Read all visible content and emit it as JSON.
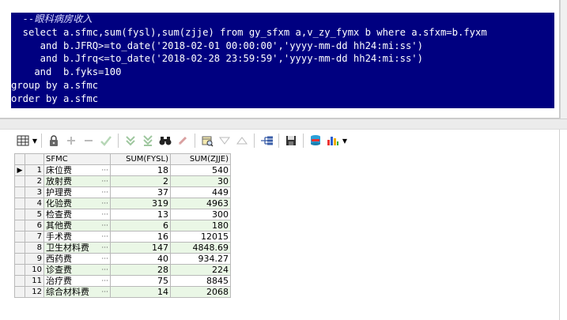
{
  "sql": {
    "lines": [
      "  --眼科病房收入",
      "  select a.sfmc,sum(fysl),sum(zjje) from gy_sfxm a,v_zy_fymx b where a.sfxm=b.fyxm",
      "     and b.JFRQ>=to_date('2018-02-01 00:00:00','yyyy-mm-dd hh24:mi:ss')",
      "     and b.Jfrq<=to_date('2018-02-28 23:59:59','yyyy-mm-dd hh24:mi:ss')",
      "    and  b.fyks=100",
      "group by a.sfmc",
      "order by a.sfmc"
    ]
  },
  "toolbar": {
    "icons": [
      "grid-view-icon",
      "lock-icon",
      "add-record-icon",
      "delete-record-icon",
      "post-check-icon",
      "fetch-next-icon",
      "fetch-all-icon",
      "find-binoculars-icon",
      "clear-icon",
      "query-by-example-icon",
      "filter-down-icon",
      "filter-up-icon",
      "tree-icon",
      "save-icon",
      "export-icon",
      "chart-icon"
    ]
  },
  "grid": {
    "columns": [
      "SFMC",
      "SUM(FYSL)",
      "SUM(ZJJE)"
    ],
    "rows": [
      {
        "n": "1",
        "sfmc": "床位费",
        "fysl": "18",
        "zjje": "540"
      },
      {
        "n": "2",
        "sfmc": "放射费",
        "fysl": "2",
        "zjje": "30"
      },
      {
        "n": "3",
        "sfmc": "护理费",
        "fysl": "37",
        "zjje": "449"
      },
      {
        "n": "4",
        "sfmc": "化验费",
        "fysl": "319",
        "zjje": "4963"
      },
      {
        "n": "5",
        "sfmc": "检查费",
        "fysl": "13",
        "zjje": "300"
      },
      {
        "n": "6",
        "sfmc": "其他费",
        "fysl": "6",
        "zjje": "180"
      },
      {
        "n": "7",
        "sfmc": "手术费",
        "fysl": "16",
        "zjje": "12015"
      },
      {
        "n": "8",
        "sfmc": "卫生材料费",
        "fysl": "147",
        "zjje": "4848.69"
      },
      {
        "n": "9",
        "sfmc": "西药费",
        "fysl": "40",
        "zjje": "934.27"
      },
      {
        "n": "10",
        "sfmc": "诊查费",
        "fysl": "28",
        "zjje": "224"
      },
      {
        "n": "11",
        "sfmc": "治疗费",
        "fysl": "75",
        "zjje": "8845"
      },
      {
        "n": "12",
        "sfmc": "综合材料费",
        "fysl": "14",
        "zjje": "2068"
      }
    ],
    "cell_ellipsis": "···",
    "current_row_marker": "▶"
  }
}
